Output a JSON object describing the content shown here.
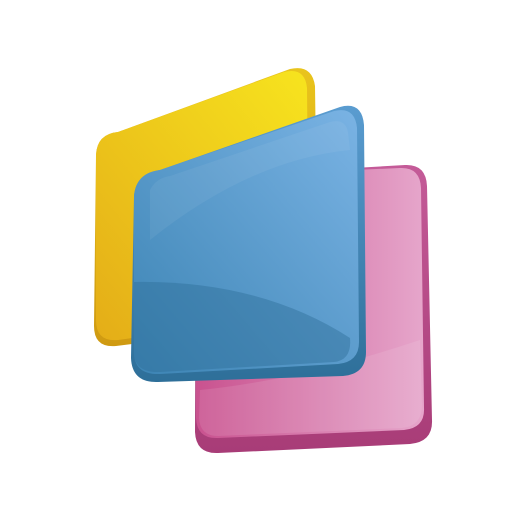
{
  "app": {
    "icon_name": "stacked-cards-logo-icon"
  },
  "colors": {
    "background": "#ffffff",
    "card_yellow_light": "#f6e21c",
    "card_yellow_dark": "#e7b41a",
    "card_yellow_edge": "#d9a514",
    "card_blue_light": "#74aee0",
    "card_blue_dark": "#3f87b6",
    "card_blue_edge": "#2f6f9a",
    "card_blue_shadow": "#3a7fae",
    "card_pink_light": "#e2a0c6",
    "card_pink_dark": "#d16aa3",
    "card_pink_edge": "#b84a86"
  }
}
